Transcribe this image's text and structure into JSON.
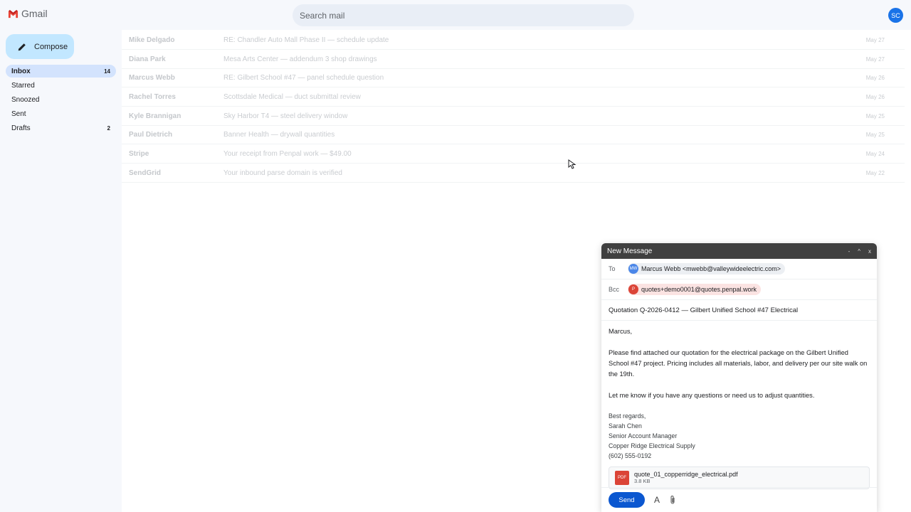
{
  "app": {
    "name": "Gmail"
  },
  "search": {
    "placeholder": "Search mail"
  },
  "account": {
    "initials": "SC"
  },
  "sidebar": {
    "compose_label": "Compose",
    "items": [
      {
        "label": "Inbox",
        "count": "14"
      },
      {
        "label": "Starred",
        "count": ""
      },
      {
        "label": "Snoozed",
        "count": ""
      },
      {
        "label": "Sent",
        "count": ""
      },
      {
        "label": "Drafts",
        "count": "2"
      }
    ]
  },
  "emails": [
    {
      "sender": "Mike Delgado",
      "subject": "RE: Chandler Auto Mall Phase II — schedule update",
      "date": "May 27"
    },
    {
      "sender": "Diana Park",
      "subject": "Mesa Arts Center — addendum 3 shop drawings",
      "date": "May 27"
    },
    {
      "sender": "Marcus Webb",
      "subject": "RE: Gilbert School #47 — panel schedule question",
      "date": "May 26"
    },
    {
      "sender": "Rachel Torres",
      "subject": "Scottsdale Medical — duct submittal review",
      "date": "May 26"
    },
    {
      "sender": "Kyle Brannigan",
      "subject": "Sky Harbor T4 — steel delivery window",
      "date": "May 25"
    },
    {
      "sender": "Paul Dietrich",
      "subject": "Banner Health — drywall quantities",
      "date": "May 25"
    },
    {
      "sender": "Stripe",
      "subject": "Your receipt from Penpal work — $49.00",
      "date": "May 24"
    },
    {
      "sender": "SendGrid",
      "subject": "Your inbound parse domain is verified",
      "date": "May 22"
    }
  ],
  "compose": {
    "title": "New Message",
    "controls": {
      "minimize": "-",
      "expand": "^",
      "close": "x"
    },
    "to_label": "To",
    "to_initials": "MW",
    "to_value": "Marcus Webb <mwebb@valleywideelectric.com>",
    "bcc_label": "Bcc",
    "bcc_initial": "P",
    "bcc_value": "quotes+demo0001@quotes.penpal.work",
    "subject": "Quotation Q-2026-0412 — Gilbert Unified School #47 Electrical",
    "greeting": "Marcus,",
    "paragraph1": "Please find attached our quotation for the electrical package on the Gilbert Unified School #47 project. Pricing includes all materials, labor, and delivery per our site walk on the 19th.",
    "paragraph2": "Let me know if you have any questions or need us to adjust quantities.",
    "signature": {
      "closing": "Best regards,",
      "name": "Sarah Chen",
      "title": "Senior Account Manager",
      "company": "Copper Ridge Electrical Supply",
      "phone": "(602) 555-0192"
    },
    "attachment": {
      "type": "PDF",
      "name": "quote_01_copperridge_electrical.pdf",
      "size": "3.8 KB"
    },
    "send_label": "Send",
    "format_label": "A"
  },
  "colors": {
    "accent": "#0b57d0",
    "compose_button": "#c2e7ff",
    "active_nav": "#d3e3fd",
    "avatar": "#1a73e8",
    "pdf": "#db4437"
  }
}
